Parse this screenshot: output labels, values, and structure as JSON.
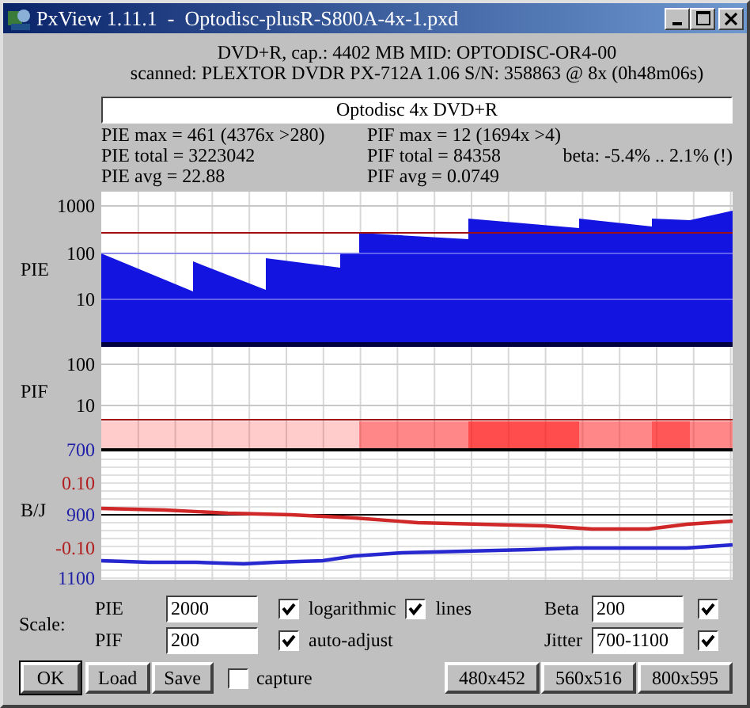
{
  "window": {
    "title": "PxView 1.11.1  -  Optodisc-plusR-S800A-4x-1.pxd"
  },
  "header": [
    "DVD+R, cap.: 4402 MB MID: OPTODISC-OR4-00",
    "scanned: PLEXTOR DVDR PX-712A 1.06 S/N: 358863 @ 8x (0h48m06s)"
  ],
  "label_field": {
    "value": "Optodisc 4x DVD+R"
  },
  "stats": {
    "column_1": [
      "PIE max = 461 (4376x >280)",
      "PIE total = 3223042",
      "PIE avg = 22.88"
    ],
    "column_2": [
      "PIF max = 12 (1694x >4)",
      "PIF total = 84358",
      "PIF avg = 0.0749"
    ],
    "beta": "beta: -5.4% .. 2.1% (!)"
  },
  "plots": [
    {
      "kind": "pie",
      "name": "PIE",
      "ticks": [
        {
          "text": "1000",
          "kind": "count"
        },
        {
          "text": "100",
          "kind": "count"
        },
        {
          "text": "10",
          "kind": "count"
        }
      ]
    },
    {
      "kind": "pif",
      "name": "PIF",
      "ticks": [
        {
          "text": "100",
          "kind": "count"
        },
        {
          "text": "10",
          "kind": "count"
        }
      ]
    },
    {
      "kind": "beta_jitter",
      "name": "B/J",
      "ticks": [
        {
          "text": "700",
          "kind": "jitter"
        },
        {
          "text": "0.10",
          "kind": "beta"
        },
        {
          "text": "900",
          "kind": "jitter"
        },
        {
          "text": "-0.10",
          "kind": "beta"
        },
        {
          "text": "1100",
          "kind": "jitter"
        }
      ]
    }
  ],
  "scale": {
    "label": "Scale:",
    "fields": [
      {
        "label": "PIE",
        "value": "2000"
      },
      {
        "label": "PIF",
        "value": "200"
      }
    ],
    "options": [
      [
        {
          "label": "logarithmic",
          "checked": true
        },
        {
          "label": "lines",
          "checked": true
        }
      ],
      [
        {
          "label": "auto-adjust",
          "checked": true
        }
      ]
    ],
    "right": [
      {
        "label": "Beta",
        "value": "200",
        "checked": true
      },
      {
        "label": "Jitter",
        "value": "700-1100",
        "checked": true
      }
    ]
  },
  "buttons": [
    {
      "label": "OK",
      "default": true
    },
    {
      "label": "Load",
      "default": false
    },
    {
      "label": "Save",
      "default": false
    }
  ],
  "capture": {
    "label": "capture",
    "checked": false
  },
  "size_buttons": [
    "480x452",
    "560x516",
    "800x595"
  ]
}
